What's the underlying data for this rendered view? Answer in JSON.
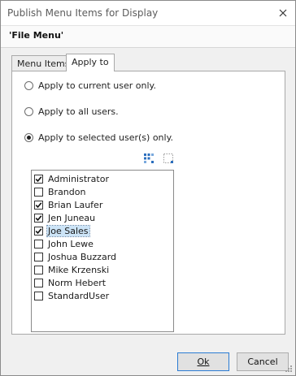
{
  "window": {
    "title": "Publish Menu Items for Display",
    "close_glyph": "✕"
  },
  "header": {
    "menu_name": "'File Menu'"
  },
  "tabs": [
    {
      "label": "Menu Items",
      "active": false
    },
    {
      "label": "Apply to",
      "active": true
    }
  ],
  "apply_options": [
    {
      "label": "Apply to current user only.",
      "checked": false
    },
    {
      "label": "Apply to all users.",
      "checked": false
    },
    {
      "label": "Apply to selected user(s) only.",
      "checked": true
    }
  ],
  "list_tools": [
    {
      "icon": "select-all-icon"
    },
    {
      "icon": "clear-selection-icon"
    }
  ],
  "users": [
    {
      "name": "Administrator",
      "checked": true,
      "selected": false
    },
    {
      "name": "Brandon",
      "checked": false,
      "selected": false
    },
    {
      "name": "Brian Laufer",
      "checked": true,
      "selected": false
    },
    {
      "name": "Jen Juneau",
      "checked": true,
      "selected": false
    },
    {
      "name": "Joe Sales",
      "checked": true,
      "selected": true
    },
    {
      "name": "John Lewe",
      "checked": false,
      "selected": false
    },
    {
      "name": "Joshua Buzzard",
      "checked": false,
      "selected": false
    },
    {
      "name": "Mike Krzenski",
      "checked": false,
      "selected": false
    },
    {
      "name": "Norm Hebert",
      "checked": false,
      "selected": false
    },
    {
      "name": "StandardUser",
      "checked": false,
      "selected": false
    }
  ],
  "footer": {
    "ok_label": "Ok",
    "cancel_label": "Cancel"
  },
  "colors": {
    "accent": "#2b7cd3",
    "selection": "#cce4f7"
  }
}
